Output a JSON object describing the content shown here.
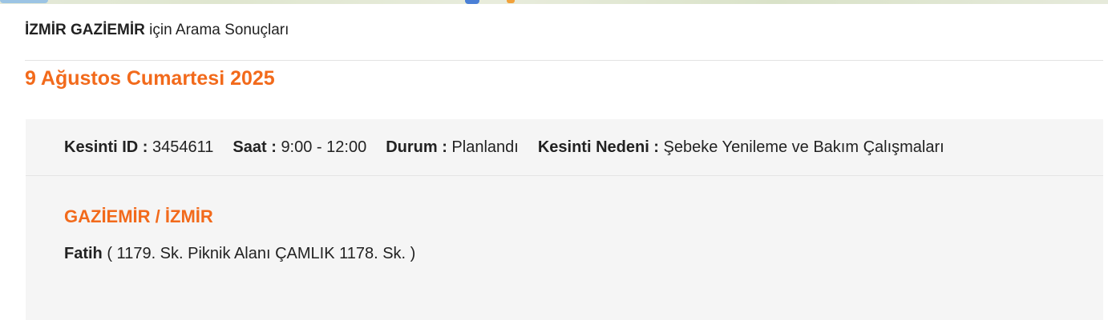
{
  "search_results": {
    "query_bold": "İZMİR GAZİEMİR",
    "title_suffix": " için Arama Sonuçları"
  },
  "date_heading": "9 Ağustos Cumartesi 2025",
  "outage": {
    "id_label": "Kesinti ID :",
    "id_value": "3454611",
    "time_label": "Saat :",
    "time_value": "9:00 - 12:00",
    "status_label": "Durum :",
    "status_value": "Planlandı",
    "reason_label": "Kesinti Nedeni :",
    "reason_value": "Şebeke Yenileme ve Bakım Çalışmaları",
    "district": "GAZİEMİR / İZMİR",
    "neighborhood_name": "Fatih",
    "streets": "( 1179. Sk. Piknik Alanı ÇAMLIK 1178. Sk. )"
  },
  "colors": {
    "accent": "#f26a1b",
    "card_bg": "#f5f5f5",
    "text": "#222222"
  }
}
